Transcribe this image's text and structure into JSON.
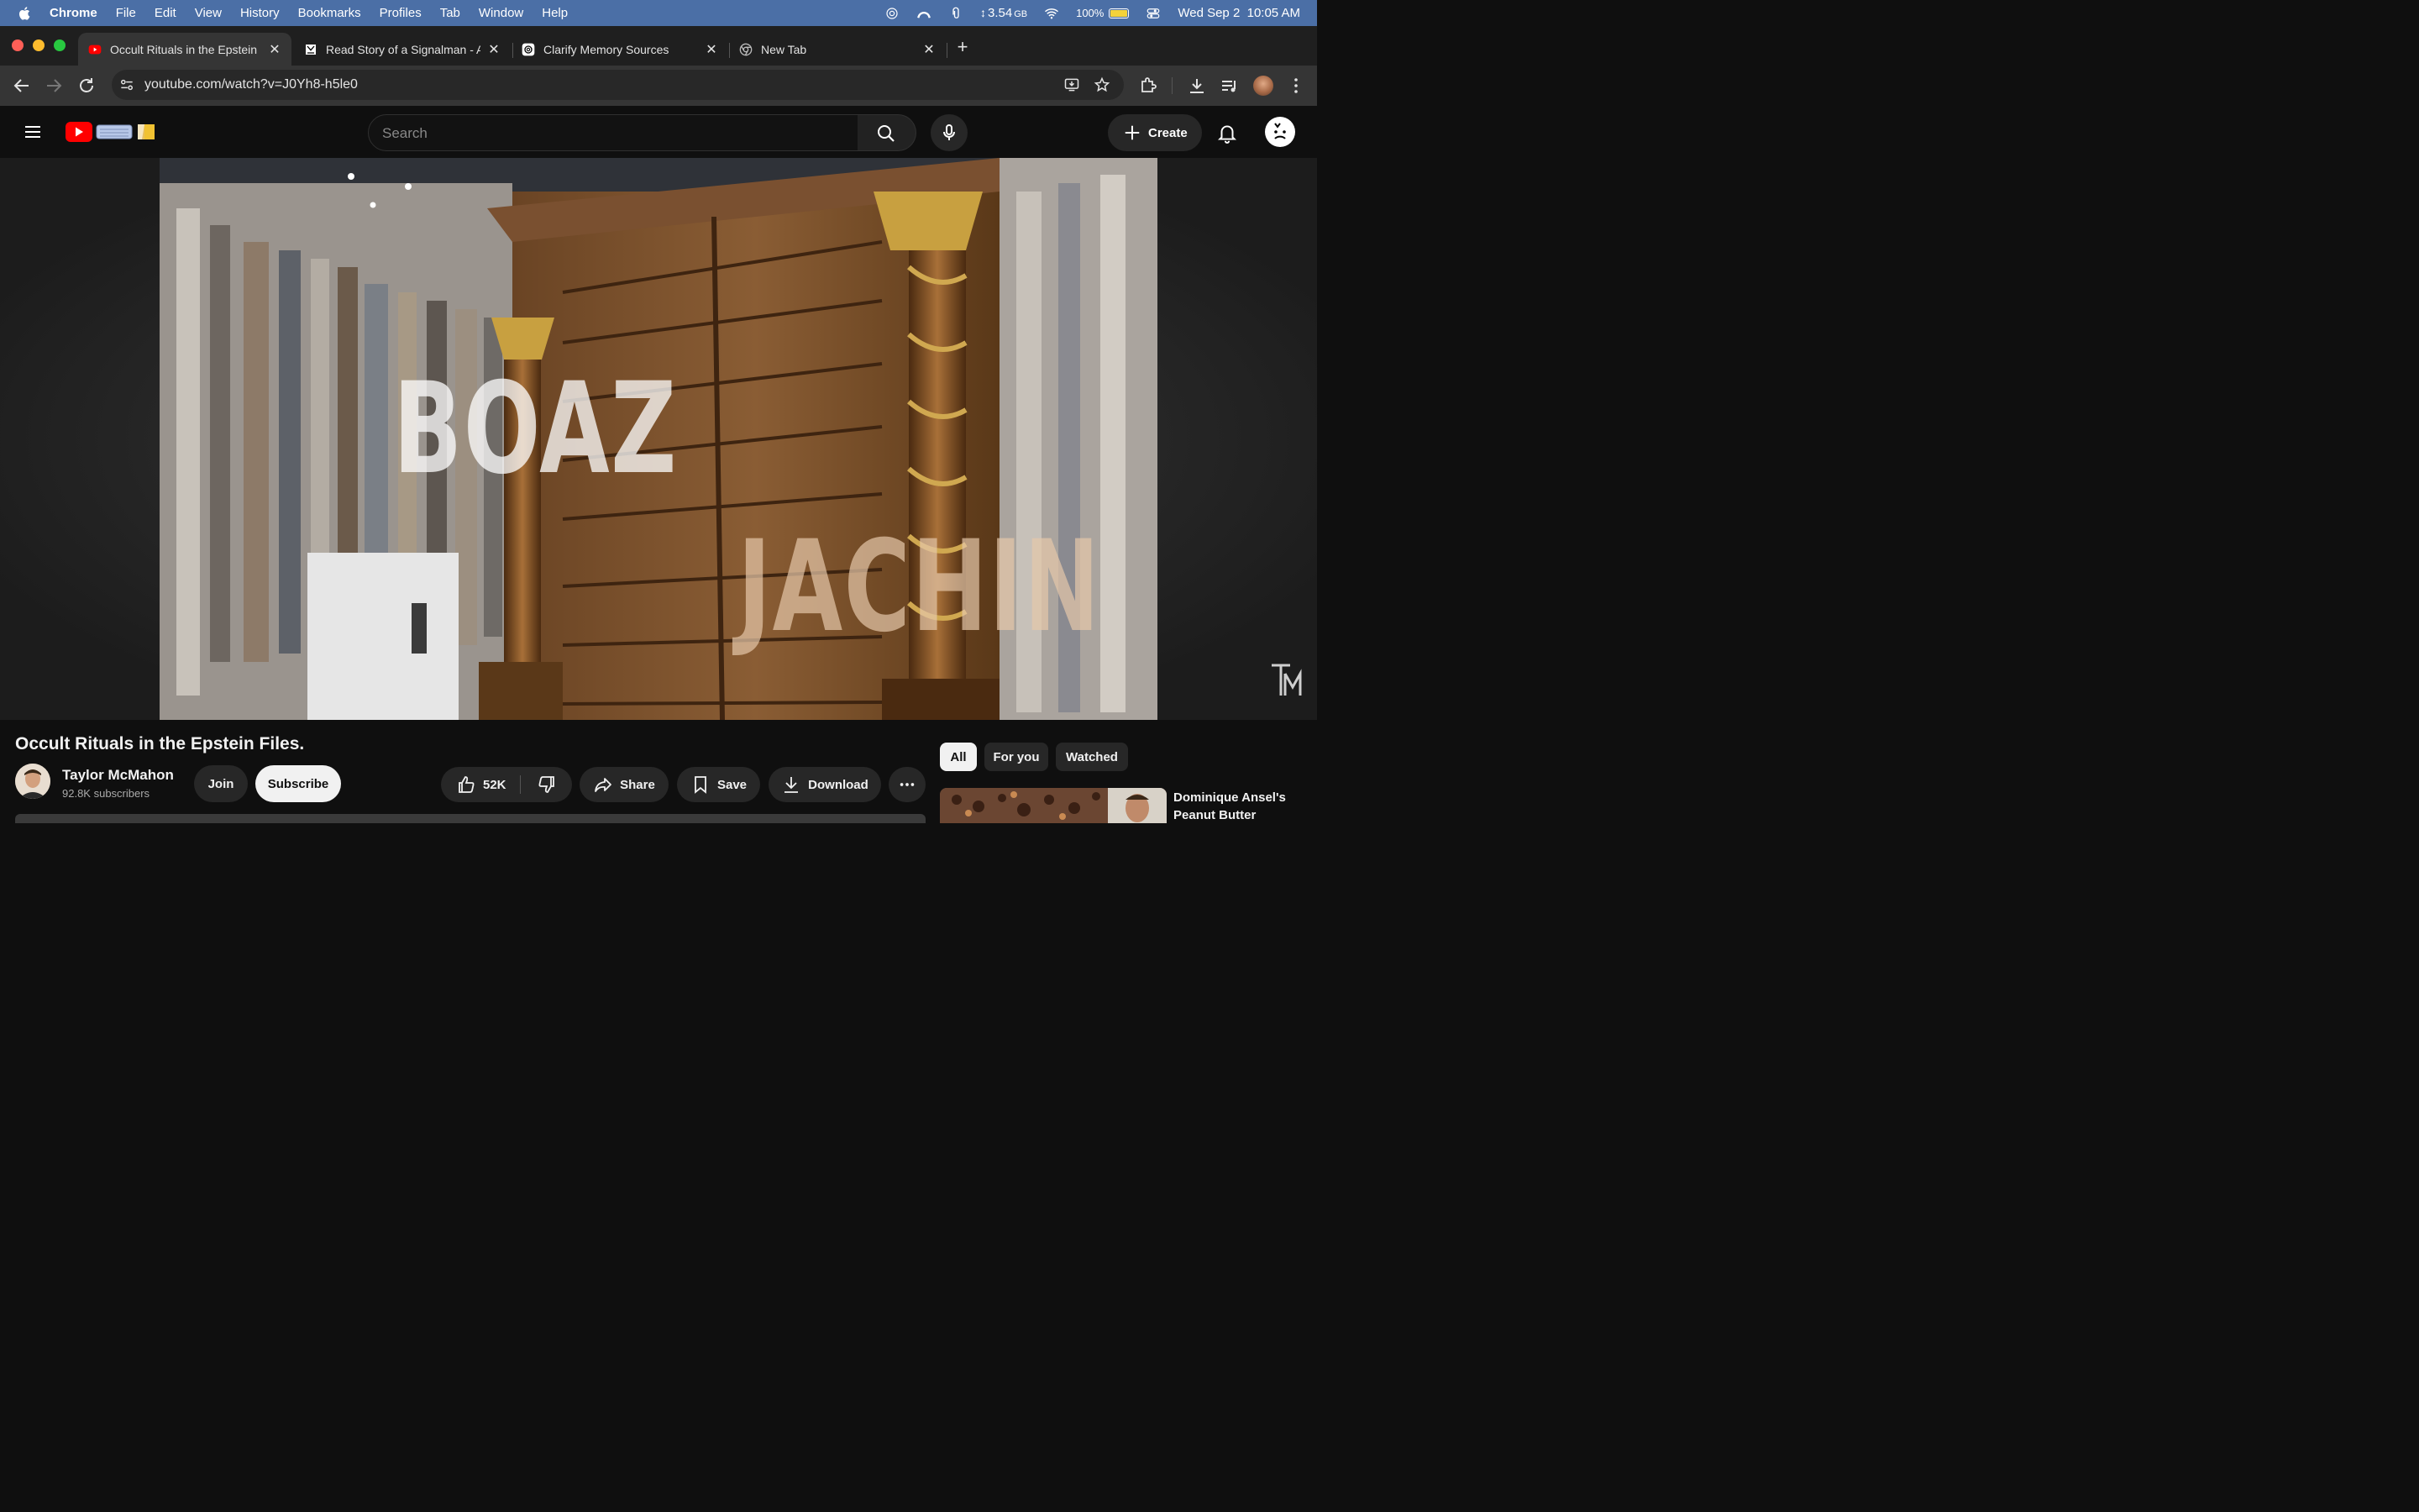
{
  "menubar": {
    "app": "Chrome",
    "items": [
      "File",
      "Edit",
      "View",
      "History",
      "Bookmarks",
      "Profiles",
      "Tab",
      "Window",
      "Help"
    ],
    "memory": "3.54",
    "memory_unit": "GB",
    "battery": "100%",
    "battery_level": 1.0,
    "datetime": "Wed Sep 2  10:05 AM"
  },
  "tabs": [
    {
      "title": "Occult Rituals in the Epstein F",
      "icon": "youtube-icon",
      "active": true
    },
    {
      "title": "Read Story of a Signalman - A",
      "icon": "book-icon",
      "active": false
    },
    {
      "title": "Clarify Memory Sources",
      "icon": "openai-icon",
      "active": false
    },
    {
      "title": "New Tab",
      "icon": "chrome-icon",
      "active": false
    }
  ],
  "address_bar": {
    "url": "youtube.com/watch?v=J0Yh8-h5le0"
  },
  "youtube": {
    "search_placeholder": "Search",
    "create_label": "Create"
  },
  "video": {
    "overlay_word_1": "BOAZ",
    "overlay_word_2": "JACHIN",
    "title": "Occult Rituals in the Epstein Files."
  },
  "channel": {
    "name": "Taylor McMahon",
    "subscribers": "92.8K subscribers",
    "join_label": "Join",
    "subscribe_label": "Subscribe"
  },
  "actions": {
    "likes": "52K",
    "share": "Share",
    "save": "Save",
    "download": "Download"
  },
  "filter_chips": [
    "All",
    "For you",
    "Watched"
  ],
  "recommendation": {
    "title_line1": "Dominique Ansel's",
    "title_line2": "Peanut Butter"
  },
  "colors": {
    "menubar": "#4b6fa6",
    "youtube_red": "#ff0000",
    "tab_active": "#353535",
    "battery_fill": "#f3d23a"
  }
}
